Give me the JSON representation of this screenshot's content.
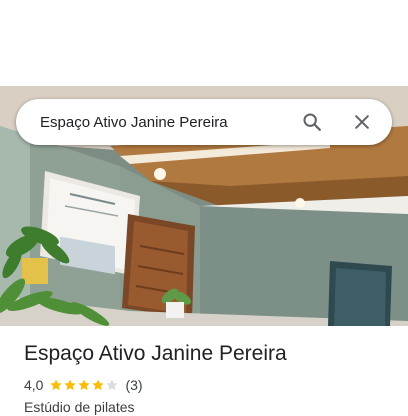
{
  "search": {
    "value": "Espaço Ativo Janine Pereira",
    "search_icon": "search-icon",
    "close_icon": "close-icon"
  },
  "place": {
    "name": "Espaço Ativo Janine Pereira",
    "rating": "4,0",
    "rating_numeric": 4.0,
    "stars_max": 5,
    "review_count": "(3)",
    "category": "Estúdio de pilates"
  },
  "colors": {
    "star_filled": "#fbbc04",
    "star_empty": "#dadce0",
    "text_primary": "#202124",
    "text_secondary": "#3c4043"
  }
}
